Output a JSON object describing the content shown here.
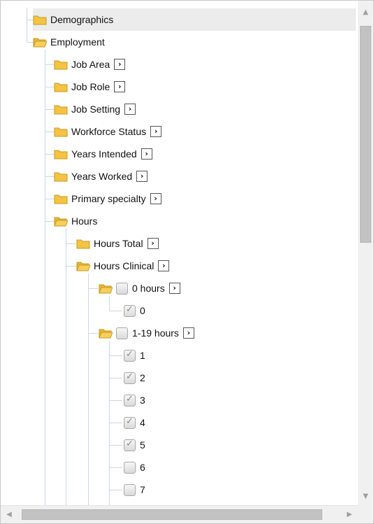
{
  "tree": {
    "root_items": {
      "demographics": "Demographics",
      "employment": "Employment"
    },
    "employment_children": [
      "Job Area",
      "Job Role",
      "Job Setting",
      "Workforce Status",
      "Years Intended",
      "Years Worked",
      "Primary specialty"
    ],
    "hours": {
      "label": "Hours",
      "hours_total": "Hours Total",
      "hours_clinical": "Hours Clinical",
      "zero_hours": {
        "label": "0 hours",
        "checked": false,
        "children": [
          {
            "label": "0",
            "checked": true
          }
        ]
      },
      "one_to_nineteen": {
        "label": "1-19 hours",
        "checked": false,
        "children": [
          {
            "label": "1",
            "checked": true
          },
          {
            "label": "2",
            "checked": true
          },
          {
            "label": "3",
            "checked": true
          },
          {
            "label": "4",
            "checked": true
          },
          {
            "label": "5",
            "checked": true
          },
          {
            "label": "6",
            "checked": false
          },
          {
            "label": "7",
            "checked": false
          }
        ]
      }
    },
    "expand_glyph": "›"
  },
  "icons": {
    "folder_closed": "folder-icon",
    "folder_open": "folder-open-icon",
    "checkbox": "checkbox",
    "expand": "chevron-right-icon"
  },
  "colors": {
    "folder_fill": "#f5c342",
    "folder_stroke": "#c79a1e",
    "tree_line": "#c8d6ea",
    "highlight": "#ececec"
  }
}
